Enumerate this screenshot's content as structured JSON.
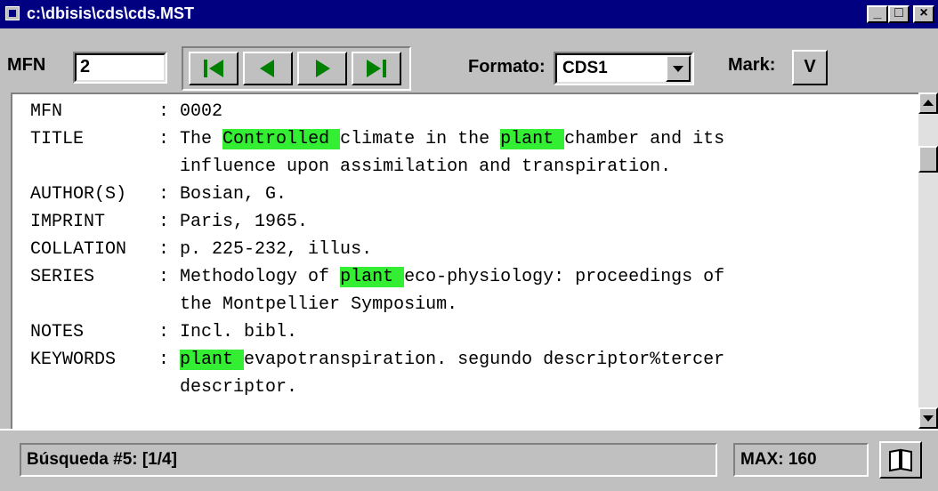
{
  "window": {
    "title": "c:\\dbisis\\cds\\cds.MST",
    "minimize": "_",
    "maximize": "□",
    "close": "×"
  },
  "toolbar": {
    "mfn_label": "MFN",
    "mfn_value": "2",
    "formato_label": "Formato:",
    "formato_value": "CDS1",
    "mark_label": "Mark:",
    "mark_button": "V",
    "nav_icons": [
      "first-record-icon",
      "previous-record-icon",
      "next-record-icon",
      "last-record-icon"
    ]
  },
  "record": {
    "highlight_color": "#33ee33",
    "fields": [
      {
        "label": "MFN",
        "lines": [
          [
            {
              "t": "0002"
            }
          ]
        ]
      },
      {
        "label": "TITLE",
        "lines": [
          [
            {
              "t": "The "
            },
            {
              "t": "Controlled ",
              "h": true
            },
            {
              "t": "climate in the "
            },
            {
              "t": "plant ",
              "h": true
            },
            {
              "t": "chamber and its"
            }
          ],
          [
            {
              "t": "influence upon assimilation and transpiration."
            }
          ]
        ]
      },
      {
        "label": "AUTHOR(S)",
        "lines": [
          [
            {
              "t": "Bosian, G."
            }
          ]
        ]
      },
      {
        "label": "IMPRINT",
        "lines": [
          [
            {
              "t": "Paris, 1965."
            }
          ]
        ]
      },
      {
        "label": "COLLATION",
        "lines": [
          [
            {
              "t": "p. 225-232, illus."
            }
          ]
        ]
      },
      {
        "label": "SERIES",
        "lines": [
          [
            {
              "t": "Methodology of "
            },
            {
              "t": "plant ",
              "h": true
            },
            {
              "t": "eco-physiology: proceedings of"
            }
          ],
          [
            {
              "t": "the Montpellier Symposium."
            }
          ]
        ]
      },
      {
        "label": "NOTES",
        "lines": [
          [
            {
              "t": "Incl. bibl."
            }
          ]
        ]
      },
      {
        "label": "KEYWORDS",
        "lines": [
          [
            {
              "t": "plant ",
              "h": true
            },
            {
              "t": "evapotranspiration. segundo descriptor%tercer"
            }
          ],
          [
            {
              "t": "descriptor."
            }
          ]
        ]
      }
    ]
  },
  "status": {
    "search": "Búsqueda #5: [1/4]",
    "max": "MAX: 160",
    "book_icon": "open-book-icon"
  }
}
